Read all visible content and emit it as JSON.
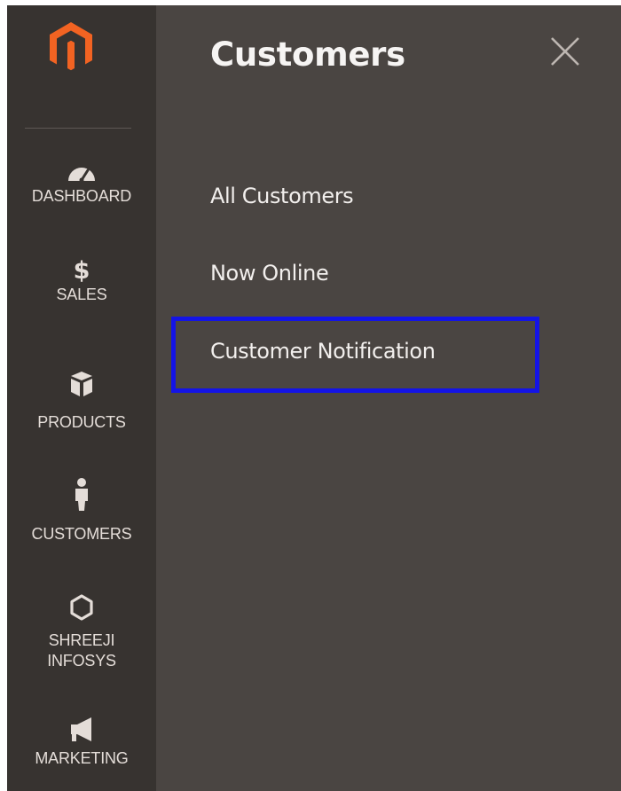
{
  "panel": {
    "title": "Customers",
    "items": [
      {
        "label": "All Customers"
      },
      {
        "label": "Now Online"
      },
      {
        "label": "Customer Notification"
      }
    ]
  },
  "nav": {
    "dashboard": {
      "label": "DASHBOARD",
      "icon": "speedometer-icon"
    },
    "sales": {
      "label": "SALES",
      "icon": "dollar-icon",
      "glyph": "$"
    },
    "products": {
      "label": "PRODUCTS",
      "icon": "box-icon"
    },
    "customers": {
      "label": "CUSTOMERS",
      "icon": "person-icon"
    },
    "shreeji": {
      "label_line1": "SHREEJI",
      "label_line2": "INFOSYS",
      "icon": "hexagon-icon"
    },
    "marketing": {
      "label": "MARKETING",
      "icon": "megaphone-icon"
    }
  },
  "colors": {
    "rail_bg": "#373330",
    "panel_bg": "#4a4542",
    "logo_orange": "#f26322",
    "highlight": "#1414e6",
    "text": "#f2efed"
  }
}
